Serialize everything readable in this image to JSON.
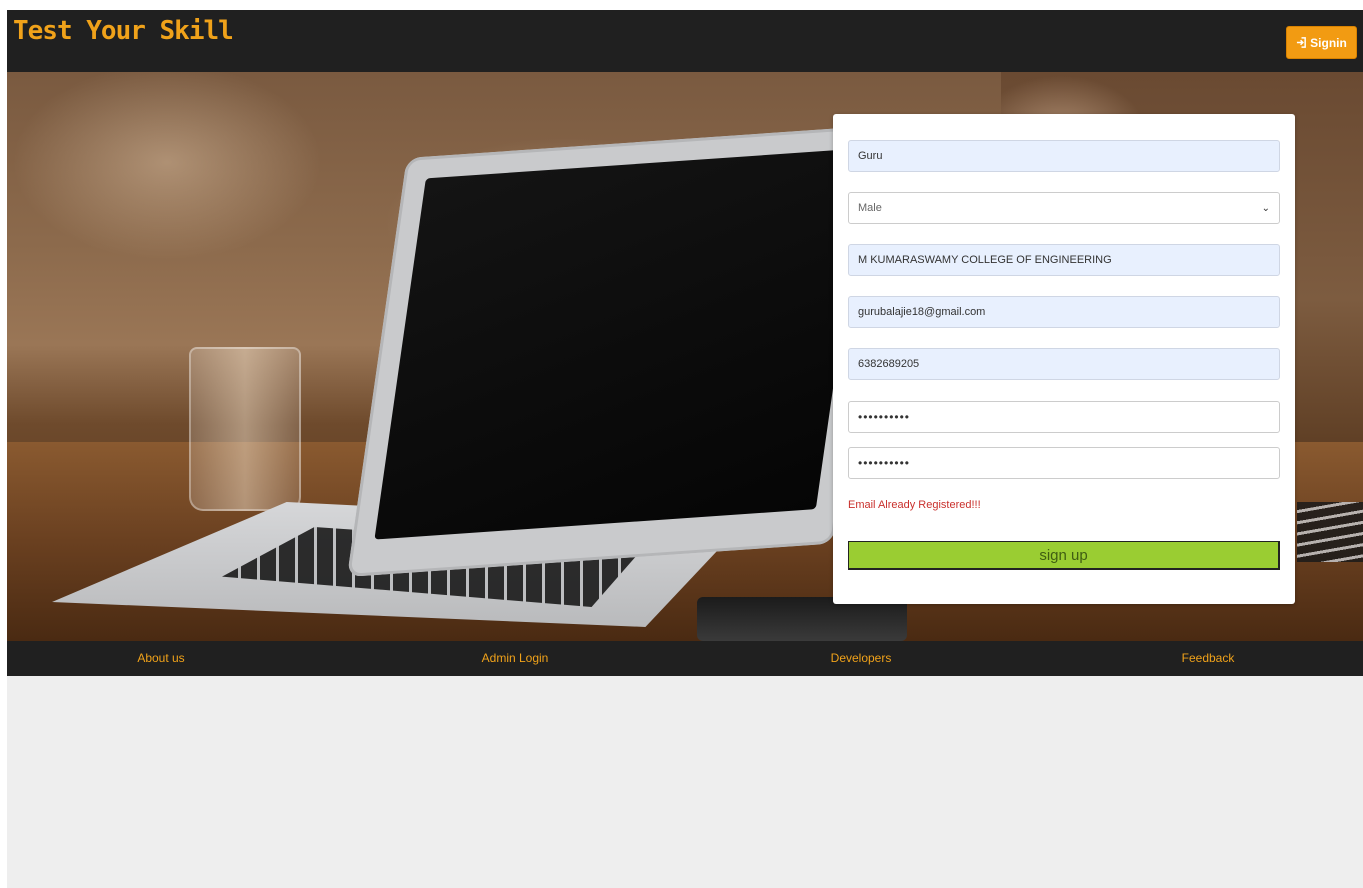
{
  "header": {
    "brand": "Test Your Skill",
    "signin_label": "Signin",
    "signin_icon": "sign-in-icon"
  },
  "form": {
    "name_value": "Guru",
    "gender_value": "Male",
    "college_value": "M KUMARASWAMY COLLEGE OF ENGINEERING",
    "email_value": "gurubalajie18@gmail.com",
    "phone_value": "6382689205",
    "password_mask": "••••••••••",
    "confirm_password_mask": "••••••••••",
    "error_message": "Email Already Registered!!!",
    "submit_label": "sign up"
  },
  "footer": {
    "links": [
      {
        "label": "About us"
      },
      {
        "label": "Admin Login"
      },
      {
        "label": "Developers"
      },
      {
        "label": "Feedback"
      }
    ]
  },
  "colors": {
    "accent": "#f0a21a",
    "bar": "#202020",
    "submit": "#9acd32",
    "error": "#c9302c",
    "autofill": "#e8f0fe"
  }
}
